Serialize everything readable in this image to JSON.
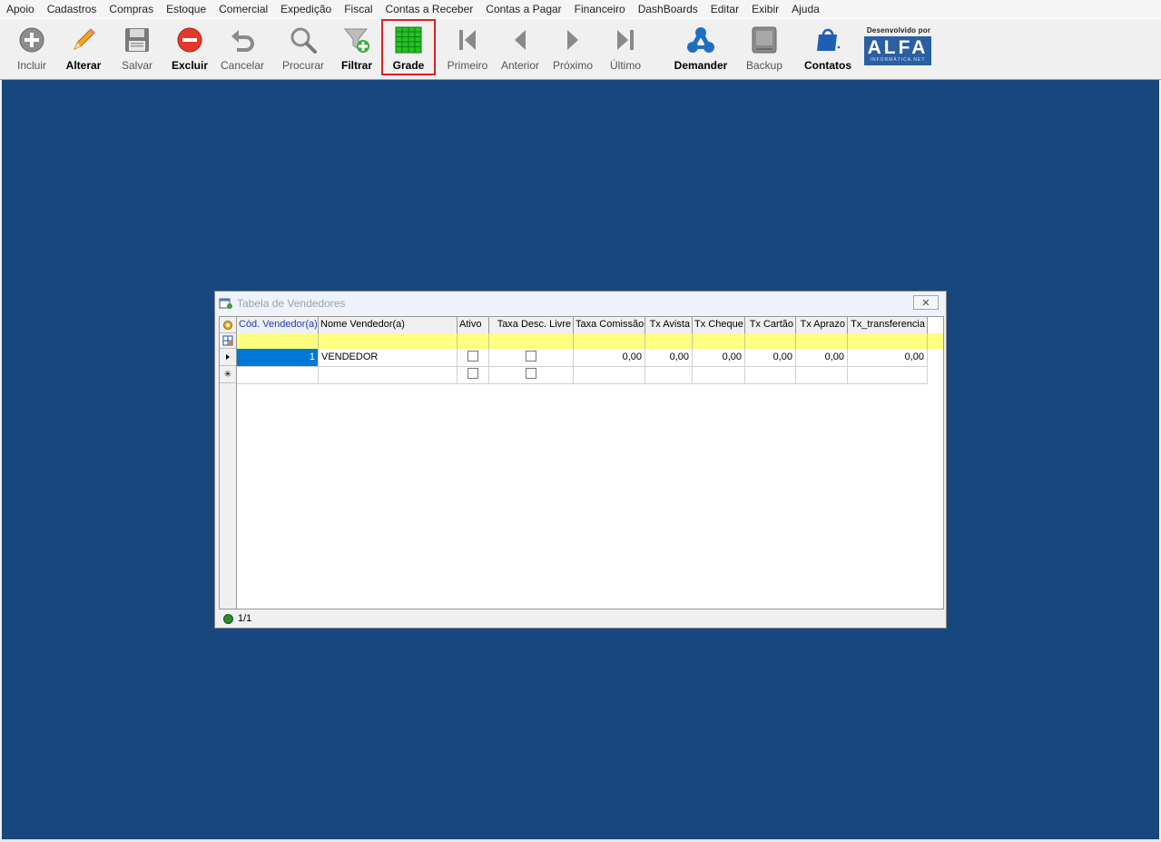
{
  "menu": [
    "Apoio",
    "Cadastros",
    "Compras",
    "Estoque",
    "Comercial",
    "Expedição",
    "Fiscal",
    "Contas a Receber",
    "Contas a Pagar",
    "Financeiro",
    "DashBoards",
    "Editar",
    "Exibir",
    "Ajuda"
  ],
  "toolbar": {
    "incluir": "Incluir",
    "alterar": "Alterar",
    "salvar": "Salvar",
    "excluir": "Excluir",
    "cancelar": "Cancelar",
    "procurar": "Procurar",
    "filtrar": "Filtrar",
    "grade": "Grade",
    "primeiro": "Primeiro",
    "anterior": "Anterior",
    "proximo": "Próximo",
    "ultimo": "Último",
    "demander": "Demander",
    "backup": "Backup",
    "contatos": "Contatos"
  },
  "logo": {
    "developed_by": "Desenvolvido por",
    "brand": "ALFA",
    "sub": "INFORMÁTICA.NET"
  },
  "colors": {
    "desktop": "#17477c",
    "filter_row": "#ffff80",
    "selection": "#0078d7",
    "highlight_border": "#e02020"
  },
  "dialog": {
    "title": "Tabela de Vendedores",
    "close": "✕",
    "columns": [
      "Cód. Vendedor(a)",
      "Nome Vendedor(a)",
      "Ativo",
      "Taxa Desc. Livre",
      "Taxa Comissão",
      "Tx Avista",
      "Tx Cheque",
      "Tx Cartão",
      "Tx Aprazo",
      "Tx_transferencia"
    ],
    "rows": [
      {
        "cod": "1",
        "nome": "VENDEDOR",
        "taxa_comissao": "0,00",
        "tx_avista": "0,00",
        "tx_cheque": "0,00",
        "tx_cartao": "0,00",
        "tx_aprazo": "0,00",
        "tx_transferencia": "0,00"
      }
    ],
    "record_count": "1/1"
  }
}
